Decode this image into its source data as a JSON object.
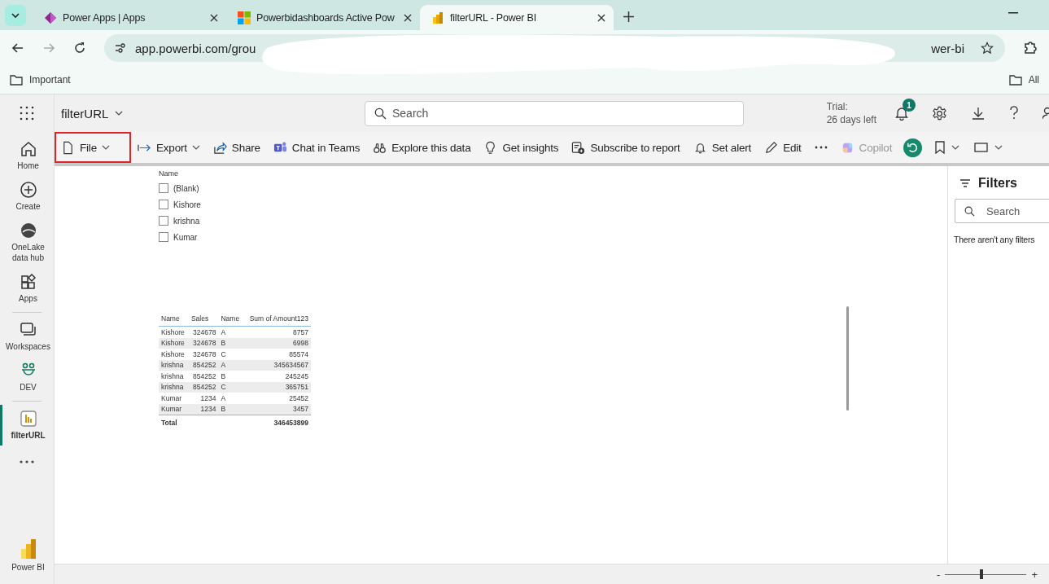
{
  "browser": {
    "tabs": [
      {
        "title": "Power Apps | Apps",
        "selected": false
      },
      {
        "title": "Powerbidashboards Active Pow",
        "selected": false
      },
      {
        "title": "filterURL - Power BI",
        "selected": true
      }
    ],
    "address": {
      "start": "app.powerbi.com/grou",
      "end": "wer-bi"
    },
    "bookmarks": [
      "Important",
      "All"
    ]
  },
  "header": {
    "report": "filterURL",
    "search": {
      "placeholder": "Search"
    },
    "trial": [
      "Trial:",
      "26 days left"
    ],
    "notifications": "1"
  },
  "toolbar": [
    {
      "label": "File",
      "dropdown": true,
      "highlighted": true,
      "disabled": false
    },
    {
      "label": "Export",
      "dropdown": true,
      "highlighted": false,
      "disabled": false
    },
    {
      "label": "Share",
      "dropdown": false,
      "highlighted": false,
      "disabled": false
    },
    {
      "label": "Chat in Teams",
      "dropdown": false,
      "highlighted": false,
      "disabled": false
    },
    {
      "label": "Explore this data",
      "dropdown": false,
      "highlighted": false,
      "disabled": false
    },
    {
      "label": "Get insights",
      "dropdown": false,
      "highlighted": false,
      "disabled": false
    },
    {
      "label": "Subscribe to report",
      "dropdown": false,
      "highlighted": false,
      "disabled": false
    },
    {
      "label": "Set alert",
      "dropdown": false,
      "highlighted": false,
      "disabled": false
    },
    {
      "label": "Edit",
      "dropdown": false,
      "highlighted": false,
      "disabled": false
    },
    {
      "label": "Copilot",
      "dropdown": false,
      "highlighted": false,
      "disabled": true
    }
  ],
  "sidebar": {
    "items": [
      {
        "label": "Home",
        "selected": false
      },
      {
        "label": "Create",
        "selected": false
      },
      {
        "label": "OneLake data hub",
        "selected": false
      },
      {
        "label": "Apps",
        "selected": false
      },
      {
        "label": "Workspaces",
        "selected": false
      },
      {
        "label": "DEV",
        "selected": false
      },
      {
        "label": "filterURL",
        "selected": true
      }
    ],
    "footer": "Power BI"
  },
  "slicer": {
    "title": "Name",
    "options": [
      {
        "label": "(Blank)",
        "checked": false
      },
      {
        "label": "Kishore",
        "checked": false
      },
      {
        "label": "krishna",
        "checked": false
      },
      {
        "label": "Kumar",
        "checked": false
      }
    ]
  },
  "table": {
    "columns": [
      "Name",
      "Sales",
      "Name",
      "Sum of Amount123"
    ],
    "rows": [
      [
        "Kishore",
        "324678",
        "A",
        "8757"
      ],
      [
        "Kishore",
        "324678",
        "B",
        "6998"
      ],
      [
        "Kishore",
        "324678",
        "C",
        "85574"
      ],
      [
        "krishna",
        "854252",
        "A",
        "345634567"
      ],
      [
        "krishna",
        "854252",
        "B",
        "245245"
      ],
      [
        "krishna",
        "854252",
        "C",
        "365751"
      ],
      [
        "Kumar",
        "1234",
        "A",
        "25452"
      ],
      [
        "Kumar",
        "1234",
        "B",
        "3457"
      ]
    ],
    "total": {
      "label": "Total",
      "value": "346453899"
    }
  },
  "filters": {
    "title": "Filters",
    "search": {
      "placeholder": "Search"
    },
    "empty": "There aren't any filters"
  },
  "zoom": {
    "minus": "-",
    "plus": "+",
    "level": 0.45
  }
}
